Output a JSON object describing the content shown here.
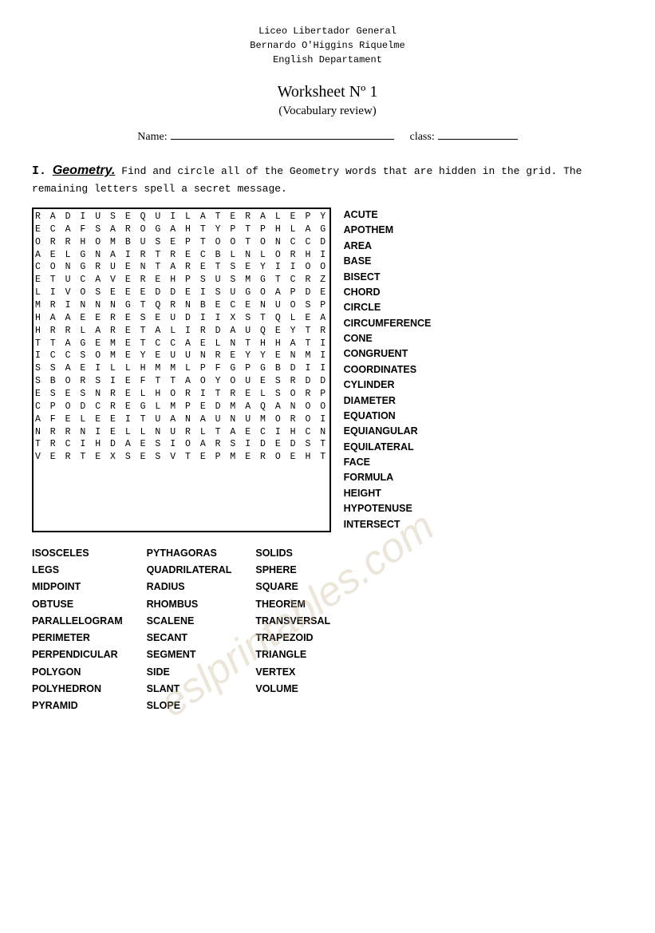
{
  "school": {
    "line1": "Liceo Libertador General",
    "line2": "Bernardo O'Higgins Riquelme",
    "line3": "English Departament"
  },
  "worksheet": {
    "title": "Worksheet Nº 1",
    "subtitle": "(Vocabulary review)"
  },
  "form": {
    "name_label": "Name:",
    "class_label": "class:"
  },
  "instructions": {
    "section": "I.",
    "subject": "Geometry.",
    "text": "Find and circle all of the Geometry words that are hidden in the grid. The remaining letters spell a secret message."
  },
  "grid_rows": [
    "R A D I U S E Q U I L A T E R A L E P Y",
    "E C A F S A R O G A H T Y P T P H L A G",
    "O R R H O M B U S E P T O O T O N C C D",
    "A E L G N A I R T R E C B L N L O R H I",
    "C O N G R U E N T A R E T S E Y I I O O",
    "E T U C A V E R E H P S U S M G T C R Z",
    "L I V O S E E E D D E I S U G O A P D E",
    "M R I N N N G T Q R N B E C E N U O S P",
    "H A A E E R E S E U D I I X S T Q L E A",
    "H R R L A R E T A L I R D A U Q E Y T R",
    "T T A G E M E T C C A E L N T H H A T I",
    "I C C S O M E Y E U U N R E Y Y E N M I",
    "S S A E I L L H M M L P F G P G B D I I",
    "S B O R S I E F T T A O Y O U E S R D D",
    "E S E S N R E L H O R I T R E L S O R P",
    "C P O D C R E G L M P E D M A Q A N O O",
    "A F E L E E I T U A N A U N U M O R O I",
    "N R R N I E L L N U R L T A E C I H C N",
    "T R C I H D A E S I O A R S I D E D S T",
    "V E R T E X S E S V T E P M E R O E H T"
  ],
  "word_list_right": [
    "ACUTE",
    "APOTHEM",
    "AREA",
    "BASE",
    "BISECT",
    "CHORD",
    "CIRCLE",
    "CIRCUMFERENCE",
    "CONE",
    "CONGRUENT",
    "COORDINATES",
    "CYLINDER",
    "DIAMETER",
    "EQUATION",
    "EQUIANGULAR",
    "EQUILATERAL",
    "FACE",
    "FORMULA",
    "HEIGHT",
    "HYPOTENUSE",
    "INTERSECT"
  ],
  "word_list_bottom": {
    "col1": [
      "ISOSCELES",
      "LEGS",
      "MIDPOINT",
      "OBTUSE",
      "PARALLELOGRAM",
      "PERIMETER",
      "PERPENDICULAR",
      "POLYGON",
      "POLYHEDRON",
      "PYRAMID"
    ],
    "col2": [
      "PYTHAGORAS",
      "QUADRILATERAL",
      "RADIUS",
      "RHOMBUS",
      "SCALENE",
      "SECANT",
      "SEGMENT",
      "SIDE",
      "SLANT",
      "SLOPE"
    ],
    "col3": [
      "SOLIDS",
      "SPHERE",
      "SQUARE",
      "THEOREM",
      "TRANSVERSAL",
      "TRAPEZOID",
      "TRIANGLE",
      "VERTEX",
      "VOLUME"
    ]
  }
}
